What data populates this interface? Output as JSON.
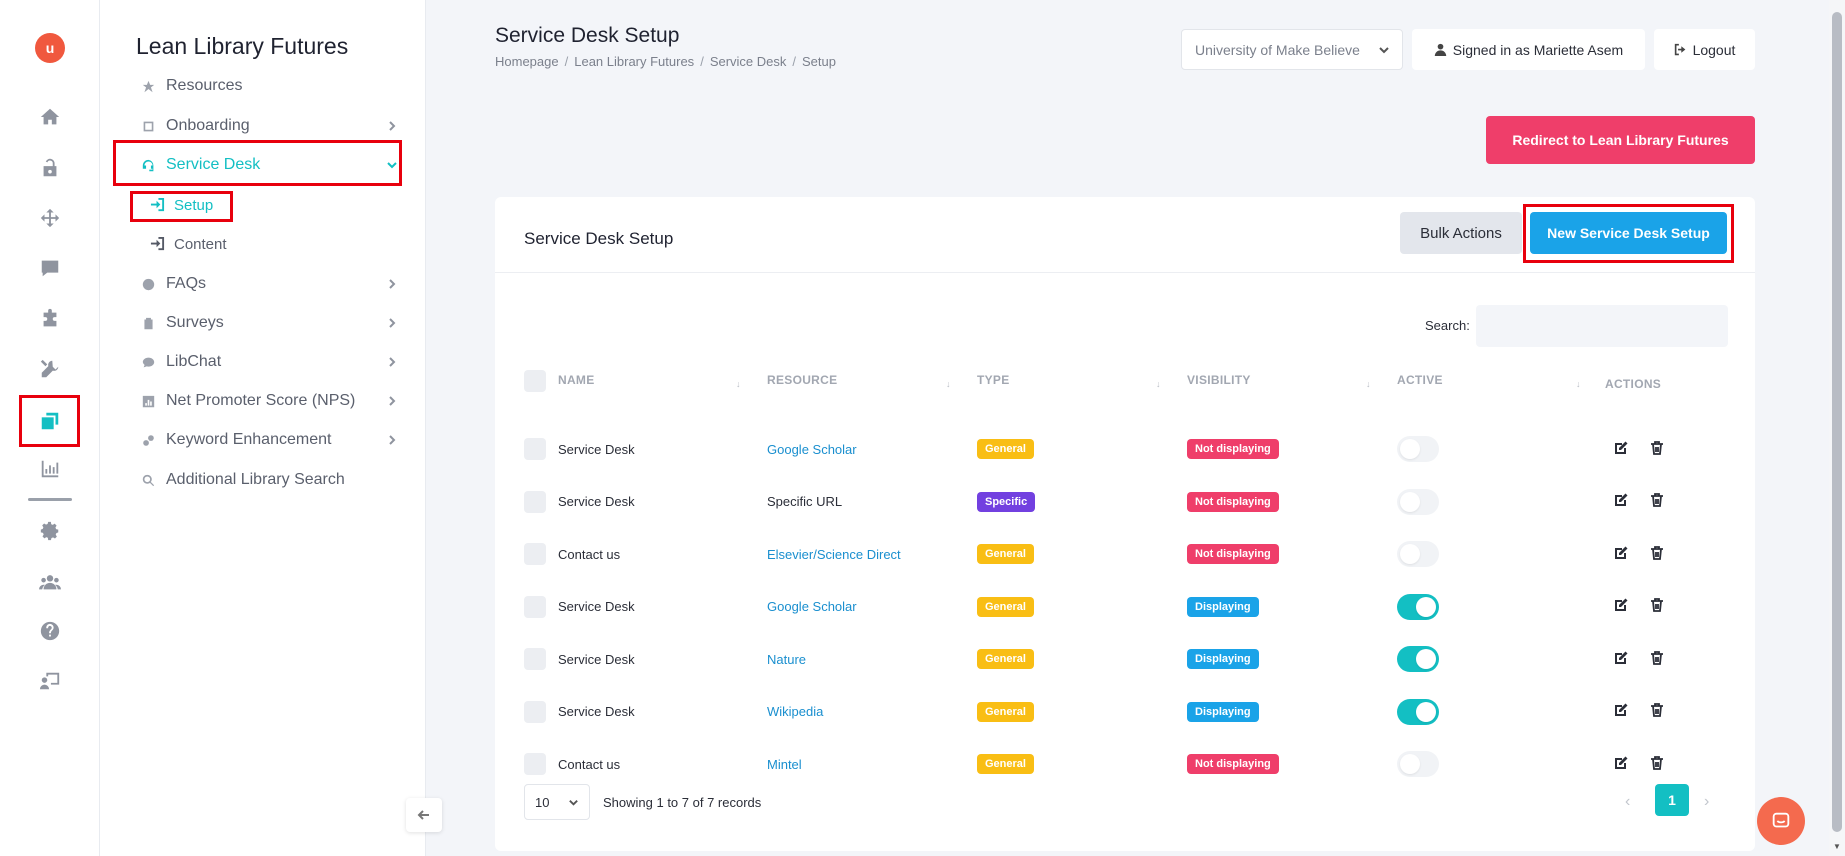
{
  "rail": {
    "logo_text": "u",
    "accent": "#13bfc3",
    "icons": [
      "home-icon",
      "unlock-icon",
      "move-icon",
      "comment-icon",
      "puzzle-icon",
      "tools-icon",
      "clone-icon",
      "chart-icon",
      "gear-icon",
      "users-icon",
      "question-icon",
      "presenter-icon"
    ]
  },
  "sidebar": {
    "brand": "Lean Library Futures",
    "items": [
      {
        "label": "Resources"
      },
      {
        "label": "Onboarding"
      },
      {
        "label": "Service Desk"
      },
      {
        "label": "Setup"
      },
      {
        "label": "Content"
      },
      {
        "label": "FAQs"
      },
      {
        "label": "Surveys"
      },
      {
        "label": "LibChat"
      },
      {
        "label": "Net Promoter Score (NPS)"
      },
      {
        "label": "Keyword Enhancement"
      },
      {
        "label": "Additional Library Search"
      }
    ]
  },
  "header": {
    "title": "Service Desk Setup",
    "breadcrumb": [
      "Homepage",
      "Lean Library Futures",
      "Service Desk",
      "Setup"
    ],
    "breadcrumb_sep": "/",
    "institution": "University of Make Believe",
    "signed_in": "Signed in as Mariette Asem",
    "logout": "Logout"
  },
  "redirect_button": "Redirect to Lean Library Futures",
  "card": {
    "title": "Service Desk Setup",
    "bulk_actions": "Bulk Actions",
    "new_setup": "New Service Desk Setup",
    "search_label": "Search:",
    "search_value": "",
    "columns": [
      "NAME",
      "RESOURCE",
      "TYPE",
      "VISIBILITY",
      "ACTIVE",
      "ACTIONS"
    ],
    "sort_glyph": "↓",
    "rows": [
      {
        "name": "Service Desk",
        "resource": "Google Scholar",
        "resource_link": true,
        "type": "General",
        "visibility": "Not displaying",
        "active": false
      },
      {
        "name": "Service Desk",
        "resource": "Specific URL",
        "resource_link": false,
        "type": "Specific",
        "visibility": "Not displaying",
        "active": false
      },
      {
        "name": "Contact us",
        "resource": "Elsevier/Science Direct",
        "resource_link": true,
        "type": "General",
        "visibility": "Not displaying",
        "active": false
      },
      {
        "name": "Service Desk",
        "resource": "Google Scholar",
        "resource_link": true,
        "type": "General",
        "visibility": "Displaying",
        "active": true
      },
      {
        "name": "Service Desk",
        "resource": "Nature",
        "resource_link": true,
        "type": "General",
        "visibility": "Displaying",
        "active": true
      },
      {
        "name": "Service Desk",
        "resource": "Wikipedia",
        "resource_link": true,
        "type": "General",
        "visibility": "Displaying",
        "active": true
      },
      {
        "name": "Contact us",
        "resource": "Mintel",
        "resource_link": true,
        "type": "General",
        "visibility": "Not displaying",
        "active": false
      }
    ],
    "page_size": "10",
    "showing": "Showing 1 to 7 of 7 records",
    "current_page": "1",
    "prev": "‹",
    "next": "›"
  }
}
